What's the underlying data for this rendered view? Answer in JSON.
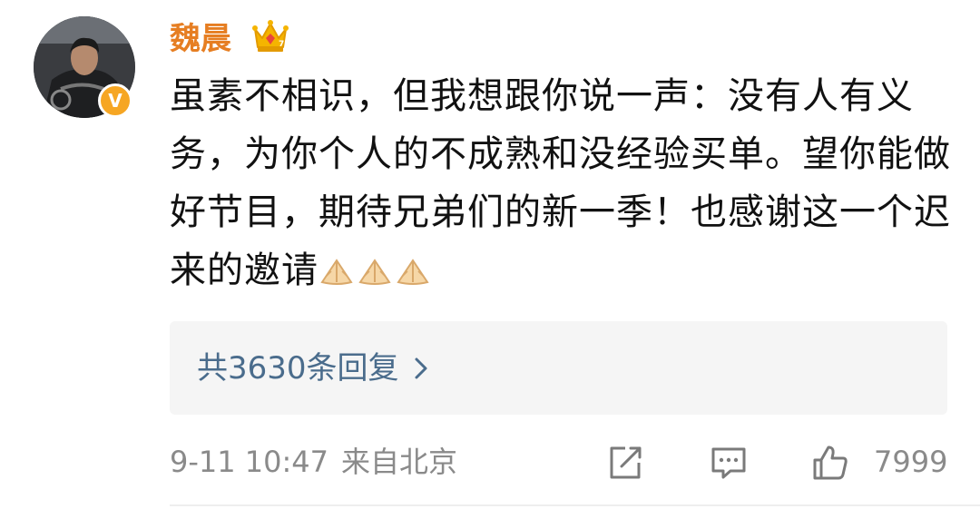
{
  "comment": {
    "username": "魏晨",
    "verified_badge": "V",
    "crown_icon": "crown-icon",
    "text": "虽素不相识，但我想跟你说一声：没有人有义务，为你个人的不成熟和没经验买单。望你能做好节目，期待兄弟们的新一季！也感谢这一个迟来的邀请",
    "emoji": [
      "pray-emoji",
      "pray-emoji",
      "pray-emoji"
    ],
    "replies_label": "共3630条回复",
    "timestamp": "9-11 10:47",
    "location": "来自北京",
    "likes": "7999"
  },
  "colors": {
    "username": "#e67e22",
    "link": "#4a6c8c",
    "meta": "#8a8a8a",
    "badge": "#f6a623",
    "reply_box_bg": "#f5f5f5"
  }
}
